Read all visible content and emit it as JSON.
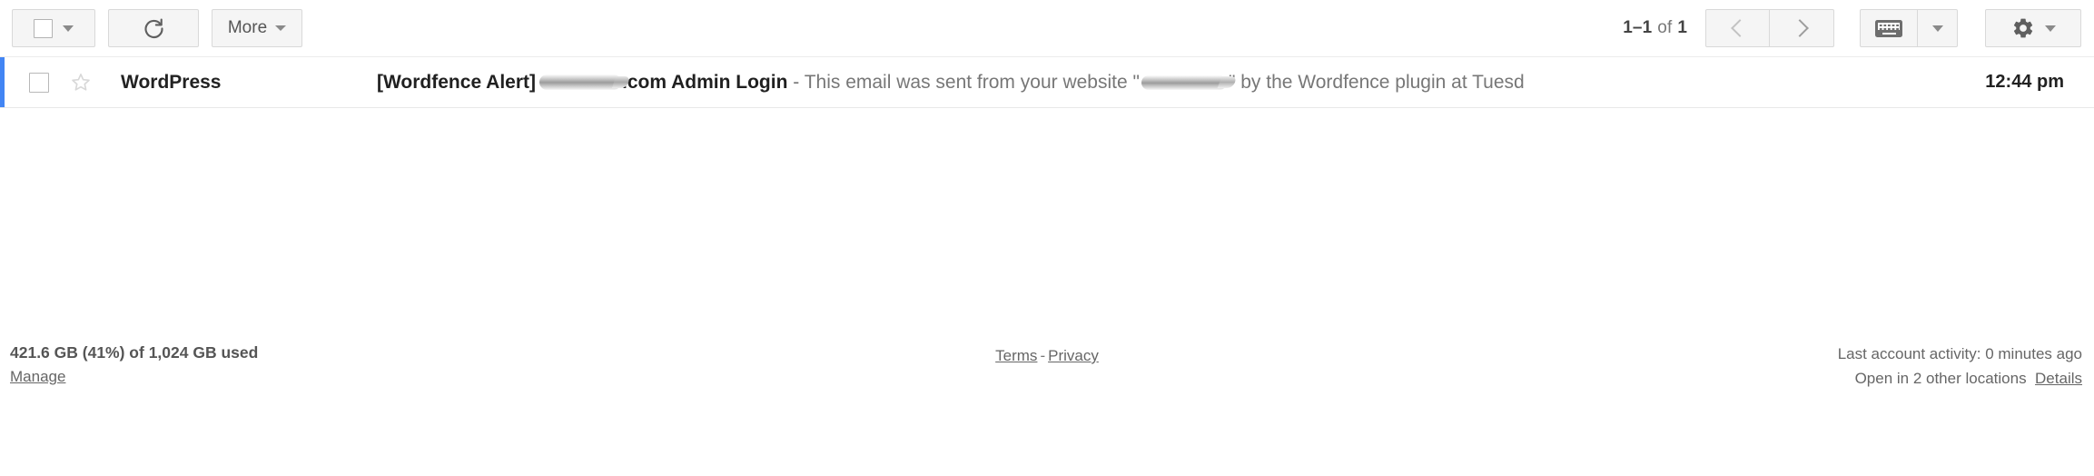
{
  "toolbar": {
    "select_all": {
      "label": "",
      "icon": "checkbox-icon",
      "dropdown_icon": "caret-down-icon"
    },
    "refresh": {
      "label": "",
      "icon": "refresh-icon"
    },
    "more": {
      "label": "More",
      "dropdown_icon": "caret-down-icon"
    },
    "pagination": {
      "range": "1–1",
      "of_word": "of",
      "total": "1"
    },
    "nav": {
      "prev_icon": "chevron-left-icon",
      "next_icon": "chevron-right-icon"
    },
    "keyboard": {
      "icon": "keyboard-icon",
      "dropdown_icon": "caret-down-icon"
    },
    "settings": {
      "icon": "gear-icon",
      "dropdown_icon": "caret-down-icon"
    }
  },
  "messages": [
    {
      "sender": "WordPress",
      "subject_prefix": "[Wordfence Alert]",
      "subject_suffix": ".com Admin Login",
      "snippet_lead": "- This email was sent from your website \"",
      "snippet_tail": "\" by the Wordfence plugin at Tuesd",
      "time": "12:44 pm",
      "unread": true,
      "checkbox_icon": "checkbox-icon",
      "star_icon": "star-outline-icon"
    }
  ],
  "footer": {
    "storage_usage": "421.6 GB (41%) of 1,024 GB used",
    "manage_label": "Manage",
    "terms_label": "Terms",
    "separator": "-",
    "privacy_label": "Privacy",
    "last_activity": "Last account activity: 0 minutes ago",
    "open_locations": "Open in 2 other locations",
    "details_label": "Details"
  },
  "colors": {
    "accent_blue": "#4285f4",
    "button_face": "#f5f5f5",
    "button_border": "#d9d9d9",
    "text_primary": "#222222",
    "text_muted": "#777777"
  }
}
